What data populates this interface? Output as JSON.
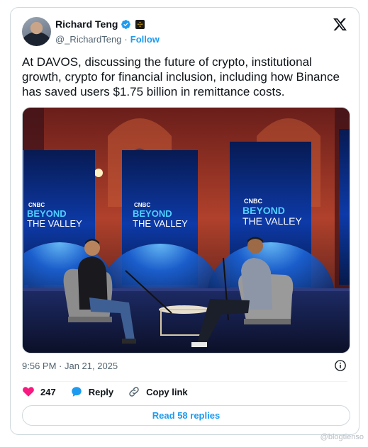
{
  "author": {
    "name": "Richard Teng",
    "handle": "@_RichardTeng",
    "separator": "·",
    "follow_label": "Follow"
  },
  "tweet": {
    "text": "At DAVOS, discussing the future of crypto, institutional growth, crypto for financial inclusion, including how Binance has saved users $1.75 billion in remittance costs.",
    "timestamp": "9:56 PM · Jan 21, 2025"
  },
  "media": {
    "screen_brand": "CNBC",
    "screen_title_line1": "BEYOND",
    "screen_title_line2": "THE VALLEY"
  },
  "actions": {
    "like_count": "247",
    "reply_label": "Reply",
    "copy_link_label": "Copy link"
  },
  "read_replies_label": "Read 58 replies",
  "watermark": "@blogtienso",
  "colors": {
    "accent": "#1d9bf0",
    "like": "#f91880",
    "text": "#0f1419",
    "muted": "#536471"
  }
}
